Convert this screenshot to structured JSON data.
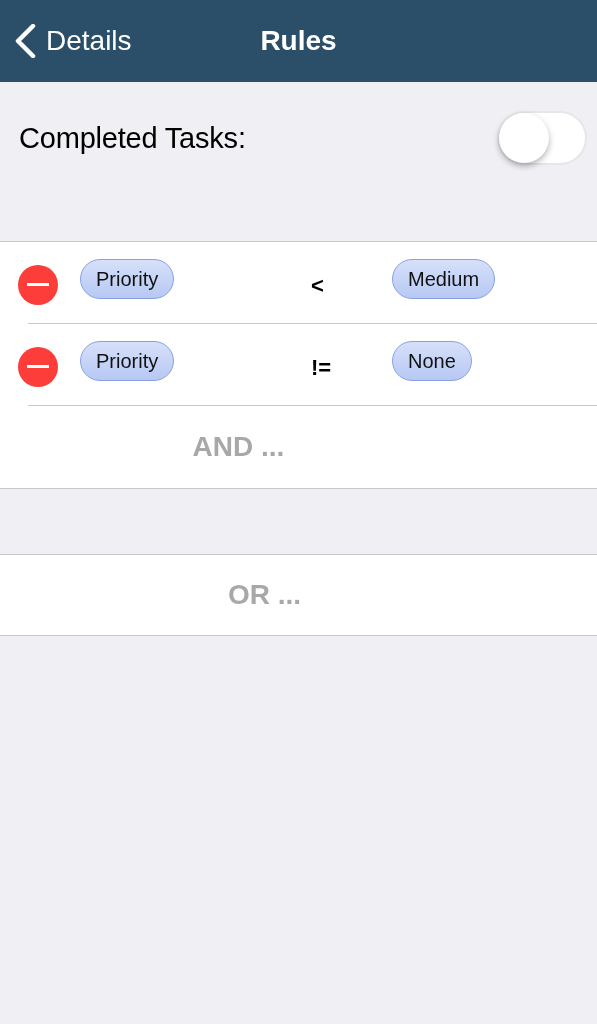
{
  "nav": {
    "back_label": "Details",
    "title": "Rules"
  },
  "completed_tasks": {
    "label": "Completed Tasks:",
    "on": false
  },
  "rules": [
    {
      "field": "Priority",
      "operator": "<",
      "value": "Medium"
    },
    {
      "field": "Priority",
      "operator": "!=",
      "value": "None"
    }
  ],
  "and_label": "AND ...",
  "or_label": "OR ..."
}
